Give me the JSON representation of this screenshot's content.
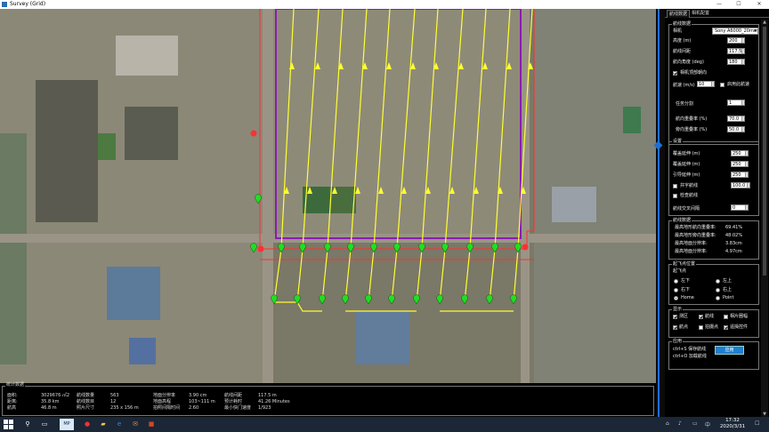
{
  "window": {
    "title": "Survey (Grid)",
    "minimize": "—",
    "maximize": "☐",
    "close": "✕"
  },
  "stats": {
    "frame_title": "统计数据",
    "rows": [
      [
        "面积:",
        "3029676 ㎡2",
        "航线数量",
        "563",
        "地面分辨率",
        "3.90  cm",
        "航线间距",
        "117.5  m"
      ],
      [
        "距离:",
        "35.8 km",
        "航线数目",
        "12",
        "地面高程",
        "103~111 m",
        "预计耗时",
        "41.26 Minutes"
      ],
      [
        "航高",
        "46.8 m",
        "照片尺寸",
        "235 x 156 m",
        "拍照间隔时间",
        "2.60",
        "最小快门速度",
        "1/923"
      ]
    ]
  },
  "panel": {
    "tabs": [
      "航线数据",
      "相机配置"
    ],
    "route_group": "航线数据",
    "camera_label": "相机",
    "camera_value": "Sony A6000_20mm",
    "altitude_label": "高度 (m)",
    "altitude": "200",
    "spacing_label": "航线间距",
    "spacing": "117.5",
    "heading_label": "航向角度 (deg)",
    "heading": "180",
    "cam_top_label": "相机顶部朝向",
    "speed_label": "航速 (m/s)",
    "speed": "10",
    "speed_check_label": "启用此航速",
    "split_label": "任务分割",
    "split": "1",
    "overlap_fwd_label": "航向重叠率 (%)",
    "overlap_fwd": "70.0",
    "overlap_side_label": "旁向重叠率 (%)",
    "overlap_side": "50.0",
    "settings_group": "设置",
    "extend_fwd_label": "覆盖延伸 (m)",
    "extend_fwd": "250",
    "extend_side_label": "覆盖延伸 (m)",
    "extend_side": "250",
    "lead_label": "引导延伸 (m)",
    "lead": "250",
    "cross_label": "井字航线",
    "cross": "100.0",
    "adv_label": "检查航线",
    "overlap_route_label": "航线交叉间隔",
    "overlap_route": "0",
    "calc_group": "航线数据",
    "calc": [
      {
        "label": "最高地形航向重叠率:",
        "value": "69.41%"
      },
      {
        "label": "最高地形旁向重叠率:",
        "value": "48.02%"
      },
      {
        "label": "最高地面分辨率:",
        "value": "3.83cm"
      },
      {
        "label": "最高地面分辨率:",
        "value": "4.97cm"
      }
    ],
    "start_group": "起飞点位置",
    "start_sub": "起飞点",
    "start_opts": [
      "左下",
      "左上",
      "右下",
      "右上",
      "Home",
      "Point"
    ],
    "display_group": "显示",
    "display_opts": [
      "测区",
      "航线",
      "相片圈幅",
      "航点",
      "拍摄点",
      "遥操控件"
    ],
    "apply_group": "应用",
    "apply_hint_1": "ctrl+S  保存航线",
    "apply_hint_2": "ctrl+O  加载航线",
    "apply_btn": "应用"
  },
  "taskbar": {
    "time": "17:32",
    "date": "2020/3/31",
    "apps": [
      "search-icon",
      "task-view-icon",
      "mission-planner-app",
      "chrome-icon",
      "explorer-icon",
      "edge-icon",
      "mail-icon",
      "office-icon"
    ],
    "lang": "中"
  },
  "colors": {
    "accent": "#1f7fd0",
    "route": "#ffff33",
    "boundary": "#8a1cb0",
    "home": "#ff2020",
    "waypoint": "#22dd22"
  }
}
